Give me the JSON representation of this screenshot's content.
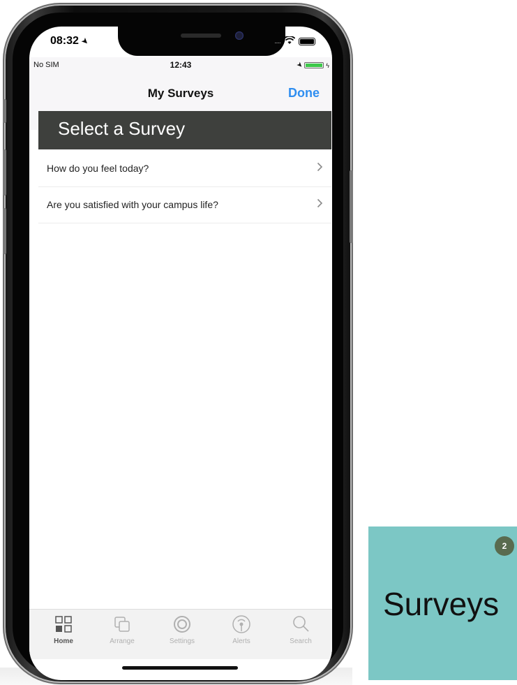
{
  "outer_status": {
    "time": "08:32",
    "dots": "....."
  },
  "inner_status": {
    "carrier": "No SIM",
    "time": "12:43"
  },
  "nav": {
    "title": "My Surveys",
    "done_label": "Done"
  },
  "section_header": "Select a Survey",
  "surveys": [
    {
      "question": "How do you feel today?"
    },
    {
      "question": "Are you satisfied with your campus life?"
    }
  ],
  "tabs": [
    {
      "label": "Home",
      "icon": "grid-icon",
      "active": true
    },
    {
      "label": "Arrange",
      "icon": "stack-icon",
      "active": false
    },
    {
      "label": "Settings",
      "icon": "gear-icon",
      "active": false
    },
    {
      "label": "Alerts",
      "icon": "broadcast-icon",
      "active": false
    },
    {
      "label": "Search",
      "icon": "search-icon",
      "active": false
    }
  ],
  "tile": {
    "label": "Surveys",
    "badge": "2",
    "color": "#7cc7c5"
  },
  "colors": {
    "header_bg": "#3e403d",
    "accent": "#2f8ef0"
  }
}
